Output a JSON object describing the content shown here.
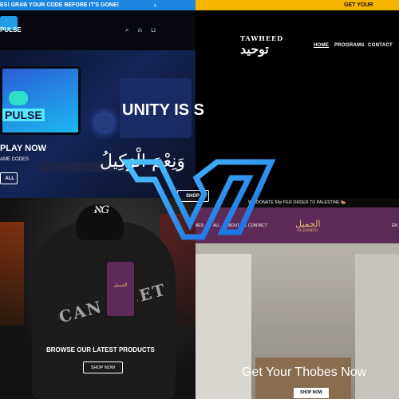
{
  "gaming": {
    "announcement": "ES! GRAB YOUR CODE BEFORE IT'S GONE!",
    "announcement_arrow": "›",
    "logo_text": "PULSE",
    "header_icons": [
      "search-icon",
      "user-icon",
      "cart-icon"
    ],
    "header_icon_glyphs": [
      "⌕",
      "⍝",
      "⊔"
    ],
    "monitor_brand": "PULSE",
    "hero_title": "PLAY NOW",
    "hero_subtitle": "AME CODES",
    "hero_button": "ALL"
  },
  "tawheed": {
    "announcement": "GET YOUR PROGRAM",
    "logo_en": "TAWHEED",
    "logo_ar": "توحيد",
    "nav": [
      "HOME",
      "PROGRAMS",
      "CONTACT"
    ],
    "hero_title": "UNITY IS S",
    "hero_arabic": "وَنِعْمَ الْوَكِيلُ",
    "hero_button": "SHOP"
  },
  "apparel": {
    "logo_sig": "ℵG",
    "shirt_print": "CAN I GET",
    "title": "BROWSE OUR LATEST PRODUCTS",
    "button": "SHOP NOW"
  },
  "thobes": {
    "announcement": "WE DONATE 50p PER ORDER TO PALESTINE 🍉",
    "nav": [
      "BES",
      "ALL",
      "ABOUT US",
      "CONTACT",
      "EN"
    ],
    "logo_ar": "الجميل",
    "logo_en": "AL-JAMEEL",
    "phone_logo": "الجميل",
    "title": "Get Your Thobes Now",
    "button": "SHOP NOW"
  },
  "colors": {
    "gaming_accent": "#1c86e0",
    "tawheed_accent": "#f5b400",
    "thobes_purple": "#5e2a57",
    "overlay_logo": "#1f8ef1"
  }
}
